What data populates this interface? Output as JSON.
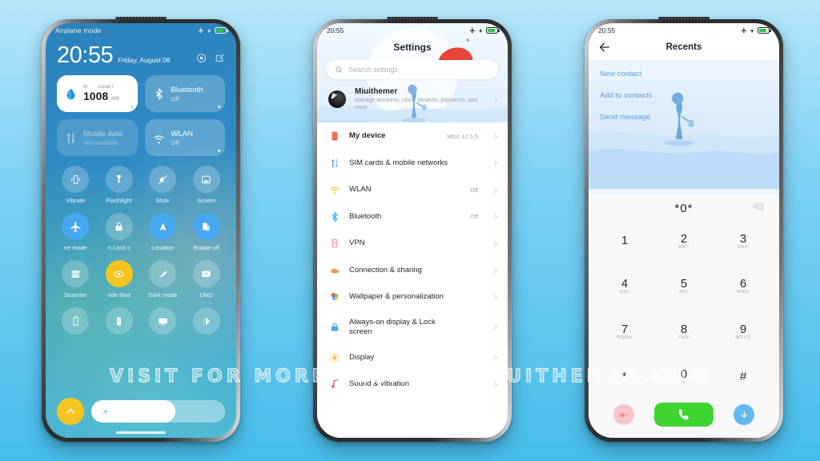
{
  "background": {
    "top_color": "#b6e6fb",
    "bottom_color": "#46bdec"
  },
  "watermark": {
    "text": "VISIT FOR MORE THEMES - MIUITHEMER.COM"
  },
  "phone1": {
    "name": "control-center",
    "status_bar": {
      "left_text": "Airplane mode",
      "airplane_icon": "airplane-icon",
      "charging_icon": "charging-bolt-icon",
      "battery_icon": "battery-icon"
    },
    "clock": {
      "time": "20:55",
      "date": "Friday, August 06",
      "settings_icon": "settings-gear-icon",
      "edit_icon": "edit-icon"
    },
    "big_tiles": [
      {
        "name": "data-usage",
        "icon": "water-drop-icon",
        "mini_left": "th",
        "mini_right": "Used t",
        "value": "1008",
        "unit": "MB",
        "style": "white"
      },
      {
        "name": "bluetooth",
        "icon": "bluetooth-icon",
        "title": "Bluetooth",
        "subtitle": "Off",
        "style": "translucent"
      },
      {
        "name": "mobile-data",
        "icon": "mobile-data-icon",
        "title": "Mobile data",
        "subtitle": "Not available",
        "style": "dim"
      },
      {
        "name": "wlan",
        "icon": "wifi-icon",
        "title": "WLAN",
        "subtitle": "Off",
        "style": "translucent"
      }
    ],
    "toggles": [
      {
        "label": "Vibrate",
        "icon": "vibrate-icon",
        "state": "off"
      },
      {
        "label": "Flashlight",
        "icon": "flashlight-icon",
        "state": "off"
      },
      {
        "label": "Mute",
        "icon": "mute-icon",
        "state": "off"
      },
      {
        "label": "Screen",
        "icon": "screenshot-icon",
        "state": "off"
      },
      {
        "label": "ne mode",
        "icon": "airplane-icon",
        "state": "on"
      },
      {
        "label": "n  Lock s",
        "icon": "lock-icon",
        "state": "off"
      },
      {
        "label": "Location",
        "icon": "location-icon",
        "state": "on"
      },
      {
        "label": "Rotate off",
        "icon": "rotate-icon",
        "state": "on"
      },
      {
        "label": "Scanner",
        "icon": "scanner-icon",
        "state": "off"
      },
      {
        "label": "ode   Rea",
        "icon": "reading-mode-icon",
        "state": "yellow"
      },
      {
        "label": "Dark mode",
        "icon": "dark-mode-icon",
        "state": "off"
      },
      {
        "label": "DND",
        "icon": "dnd-icon",
        "state": "off"
      },
      {
        "label": "",
        "icon": "battery-saver-icon",
        "state": "off"
      },
      {
        "label": "",
        "icon": "battery-alert-icon",
        "state": "off"
      },
      {
        "label": "",
        "icon": "cast-icon",
        "state": "off"
      },
      {
        "label": "",
        "icon": "contrast-icon",
        "state": "off"
      }
    ],
    "brightness": {
      "button_icon": "auto-brightness-icon",
      "slider_icon": "brightness-icon",
      "level_percent": 63
    }
  },
  "phone2": {
    "name": "settings",
    "status_bar": {
      "time": "20:55",
      "airplane_icon": "airplane-icon",
      "charging_icon": "charging-bolt-icon",
      "battery_icon": "battery-icon"
    },
    "title": "Settings",
    "search": {
      "icon": "search-icon",
      "placeholder": "Search settings",
      "value": ""
    },
    "account": {
      "avatar": "avatar",
      "name": "Miuithemer",
      "subtitle": "Manage accounts, cloud services, payments, and more"
    },
    "rows": [
      {
        "label": "My device",
        "icon": "phone-device-icon",
        "value": "MIUI 12.5.5",
        "tall": false
      },
      {
        "label": "SIM cards & mobile networks",
        "icon": "sim-card-icon",
        "value": "",
        "tall": false
      },
      {
        "label": "WLAN",
        "icon": "wifi-icon",
        "value": "Off",
        "tall": false
      },
      {
        "label": "Bluetooth",
        "icon": "bluetooth-icon",
        "value": "Off",
        "tall": false
      },
      {
        "label": "VPN",
        "icon": "vpn-icon",
        "value": "",
        "tall": false
      },
      {
        "label": "Connection & sharing",
        "icon": "connection-sharing-icon",
        "value": "",
        "tall": false
      },
      {
        "label": "Wallpaper & personalization",
        "icon": "wallpaper-icon",
        "value": "",
        "tall": false
      },
      {
        "label": "Always-on display & Lock screen",
        "icon": "lock-screen-icon",
        "value": "",
        "tall": true
      },
      {
        "label": "Display",
        "icon": "display-icon",
        "value": "",
        "tall": false
      },
      {
        "label": "Sound & vibration",
        "icon": "sound-icon",
        "value": "",
        "tall": false
      }
    ]
  },
  "phone3": {
    "name": "dialer-recents",
    "status_bar": {
      "time": "20:55",
      "airplane_icon": "airplane-icon",
      "charging_icon": "charging-bolt-icon",
      "battery_icon": "battery-icon"
    },
    "header": {
      "back_icon": "back-arrow-icon",
      "title": "Recents"
    },
    "actions": [
      {
        "label": "New contact"
      },
      {
        "label": "Add to contacts"
      },
      {
        "label": "Send message"
      }
    ],
    "dialed_number": "*0*",
    "delete_icon": "backspace-icon",
    "keys": [
      {
        "digit": "1",
        "sub": ""
      },
      {
        "digit": "2",
        "sub": "ABC"
      },
      {
        "digit": "3",
        "sub": "DEF"
      },
      {
        "digit": "4",
        "sub": "GHI"
      },
      {
        "digit": "5",
        "sub": "JKL"
      },
      {
        "digit": "6",
        "sub": "MNO"
      },
      {
        "digit": "7",
        "sub": "PQRS"
      },
      {
        "digit": "8",
        "sub": "TUV"
      },
      {
        "digit": "9",
        "sub": "WXYZ"
      },
      {
        "digit": "*",
        "sub": ""
      },
      {
        "digit": "0",
        "sub": "+"
      },
      {
        "digit": "#",
        "sub": ""
      }
    ],
    "bottom": {
      "left_icon": "video-call-icon",
      "call_icon": "phone-call-icon",
      "right_icon": "hide-keypad-icon",
      "call_color": "#3ed430"
    }
  }
}
